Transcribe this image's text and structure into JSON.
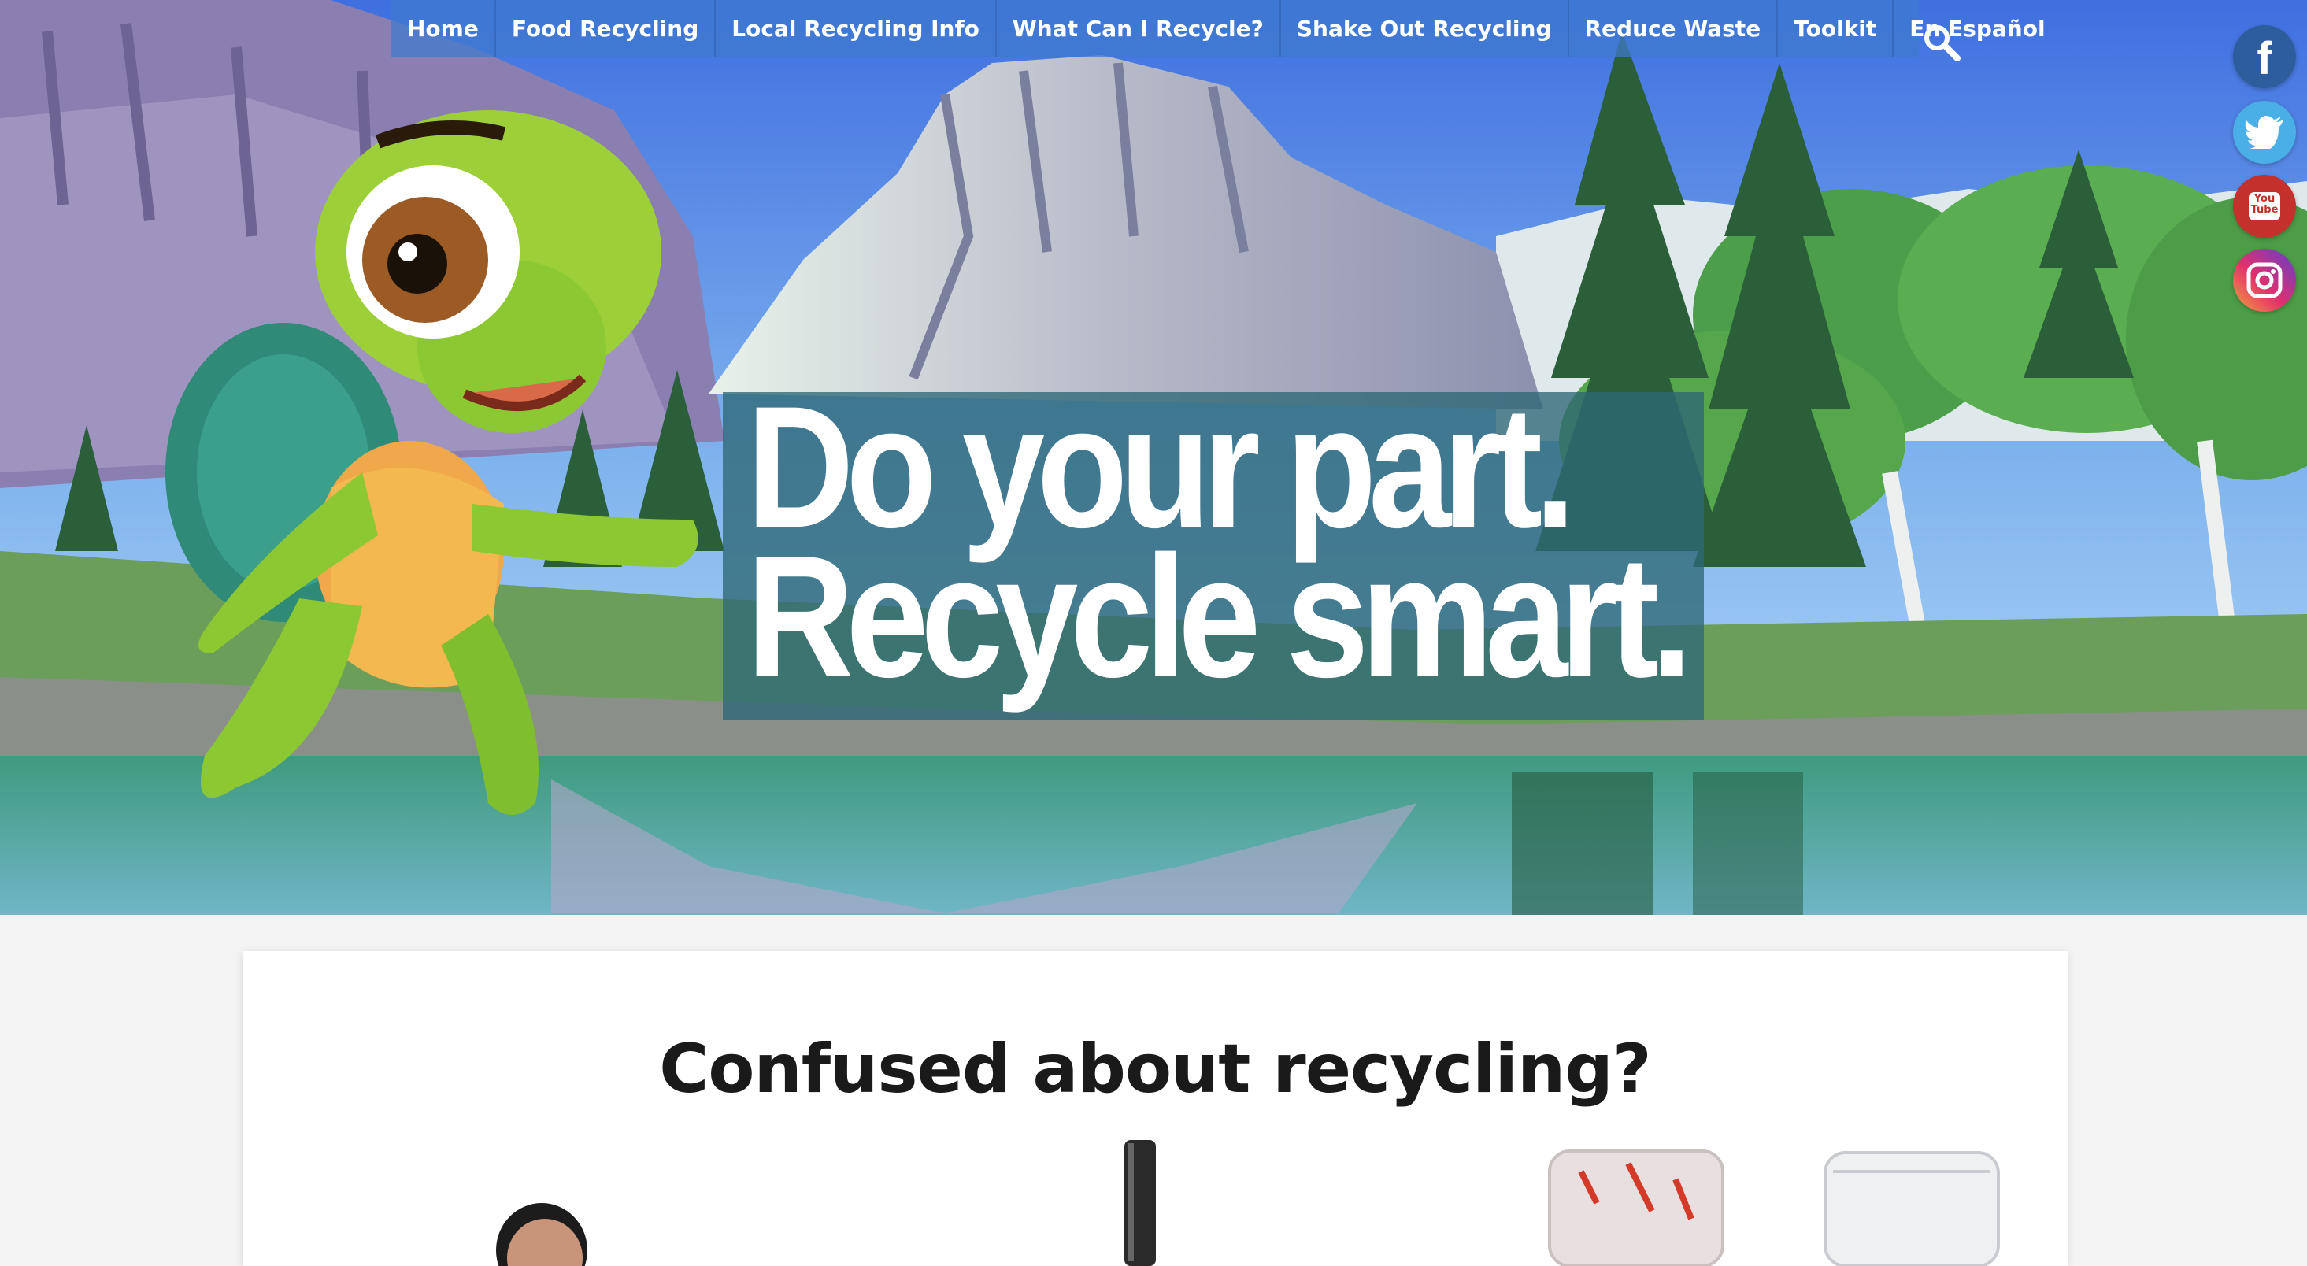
{
  "nav": {
    "items": [
      {
        "label": "Home"
      },
      {
        "label": "Food Recycling"
      },
      {
        "label": "Local Recycling Info"
      },
      {
        "label": "What Can I Recycle?"
      },
      {
        "label": "Shake Out Recycling"
      },
      {
        "label": "Reduce Waste"
      },
      {
        "label": "Toolkit"
      },
      {
        "label": "En Español"
      }
    ],
    "search_icon": "search-icon"
  },
  "social": {
    "facebook_glyph": "f",
    "youtube_line1": "You",
    "youtube_line2": "Tube",
    "icons": [
      "facebook-icon",
      "twitter-icon",
      "youtube-icon",
      "instagram-icon"
    ]
  },
  "hero": {
    "headline_line1": "Do your part.",
    "headline_line2": "Recycle smart."
  },
  "main": {
    "heading": "Confused about recycling?"
  },
  "colors": {
    "nav_bg": "#3e7ace",
    "headline_bg": "#2e6876",
    "facebook": "#2d5d9c",
    "twitter": "#4aaee7",
    "youtube": "#c4302b"
  }
}
